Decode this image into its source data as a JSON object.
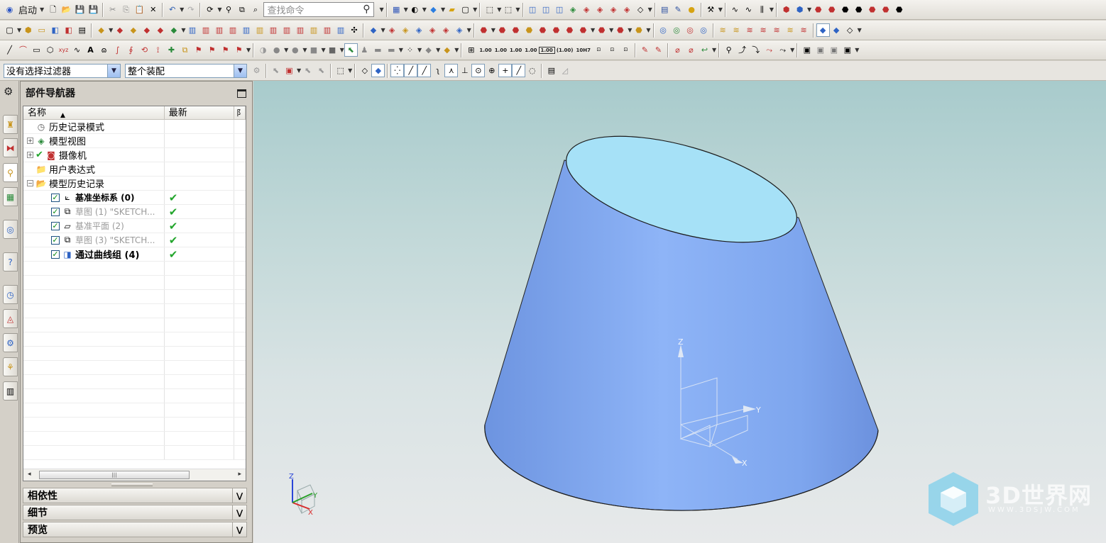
{
  "toolbar": {
    "start_label": "启动",
    "search_placeholder": "查找命令",
    "tolerance_values": [
      "1.00",
      "1.00",
      "1.00",
      "1.00",
      "1.00",
      "(1.00)",
      "10H7"
    ]
  },
  "selection": {
    "filter_value": "没有选择过滤器",
    "scope_value": "整个装配"
  },
  "navigator": {
    "title": "部件导航器",
    "col_name": "名称",
    "col_latest": "最新",
    "col_extra": "阝",
    "nodes": [
      {
        "label": "历史记录模式"
      },
      {
        "label": "模型视图"
      },
      {
        "label": "摄像机"
      },
      {
        "label": "用户表达式"
      },
      {
        "label": "模型历史记录"
      },
      {
        "label": "基准坐标系 (0)"
      },
      {
        "label": "草图 (1) \"SKETCH..."
      },
      {
        "label": "基准平面 (2)"
      },
      {
        "label": "草图 (3) \"SKETCH..."
      },
      {
        "label": "通过曲线组 (4)"
      }
    ],
    "sections": [
      "相依性",
      "细节",
      "预览"
    ]
  },
  "viewport": {
    "csys_labels": {
      "z": "Z",
      "y": "Y",
      "x": "X"
    },
    "triad_labels": {
      "z": "Z",
      "y": "Y",
      "x": "X"
    },
    "watermark_main": "3D世界网",
    "watermark_sub": "WWW.3DSJW.COM"
  },
  "colors": {
    "body_fill": "#7fa6ee",
    "top_face": "#a6e1f7",
    "check_green": "#22a52c",
    "background_top": "#a8cbcc"
  }
}
